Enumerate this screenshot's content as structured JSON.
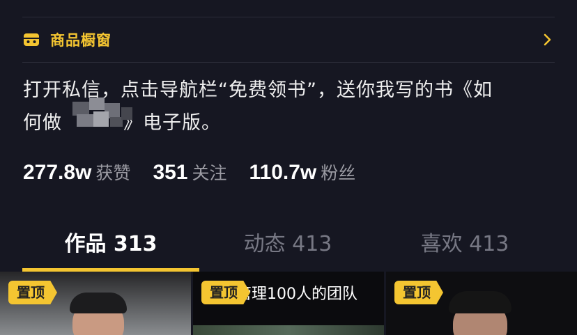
{
  "showcase": {
    "label": "商品橱窗",
    "icon": "shop-icon",
    "accent": "#f4c531"
  },
  "bio": {
    "line1": "打开私信，点击导航栏“免费领书”，送你我写的书《如",
    "line2_prefix": "何做",
    "line2_suffix": "》电子版。"
  },
  "stats": [
    {
      "value": "277.8w",
      "label": "获赞"
    },
    {
      "value": "351",
      "label": "关注"
    },
    {
      "value": "110.7w",
      "label": "粉丝"
    }
  ],
  "tabs": [
    {
      "label": "作品 313",
      "active": true
    },
    {
      "label": "动态 413",
      "active": false
    },
    {
      "label": "喜欢 413",
      "active": false
    }
  ],
  "videos": [
    {
      "pin": "置顶",
      "title": ""
    },
    {
      "pin": "置顶",
      "title": "管理100人的团队"
    },
    {
      "pin": "置顶",
      "title": ""
    }
  ]
}
